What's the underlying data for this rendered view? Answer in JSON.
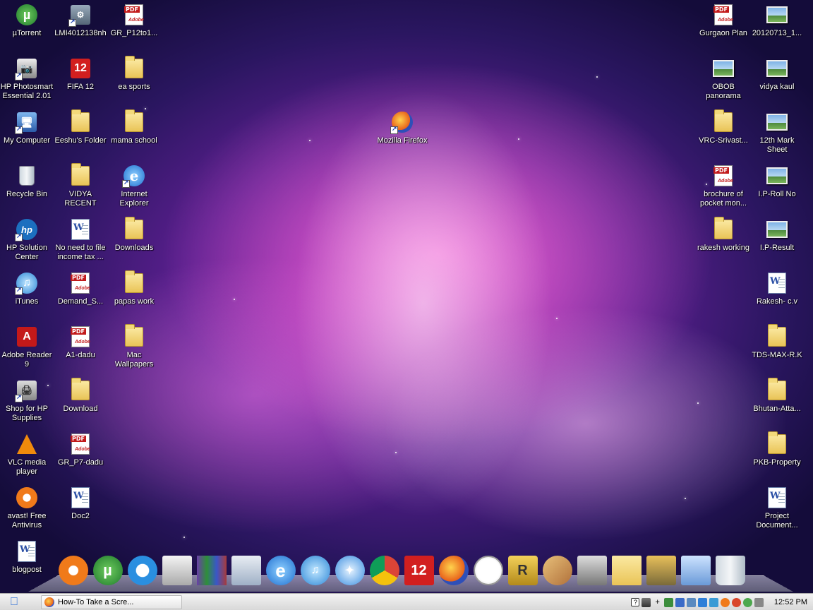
{
  "desktop": {
    "left_icons": [
      {
        "label": "µTorrent",
        "kind": "utorrent"
      },
      {
        "label": "LMI4012138nh",
        "kind": "installer"
      },
      {
        "label": "GR_P12to1...",
        "kind": "pdf"
      },
      {
        "label": "HP Photosmart Essential 2.01",
        "kind": "hp-photo"
      },
      {
        "label": "FIFA 12",
        "kind": "fifa"
      },
      {
        "label": "ea sports",
        "kind": "folder"
      },
      {
        "label": "My Computer",
        "kind": "computer"
      },
      {
        "label": "Eeshu's Folder",
        "kind": "folder"
      },
      {
        "label": "mama school",
        "kind": "folder"
      },
      {
        "label": "Recycle Bin",
        "kind": "recycle"
      },
      {
        "label": "VIDYA RECENT COLLEGES",
        "kind": "folder"
      },
      {
        "label": "Internet Explorer",
        "kind": "ie"
      },
      {
        "label": "HP Solution Center",
        "kind": "hp"
      },
      {
        "label": "No need to file income tax ...",
        "kind": "doc"
      },
      {
        "label": "Downloads",
        "kind": "folder"
      },
      {
        "label": "iTunes",
        "kind": "itunes"
      },
      {
        "label": "Demand_S...",
        "kind": "pdf"
      },
      {
        "label": "papas work",
        "kind": "folder"
      },
      {
        "label": "Adobe Reader 9",
        "kind": "adobe"
      },
      {
        "label": "A1-dadu",
        "kind": "pdf"
      },
      {
        "label": "Mac Wallpapers",
        "kind": "folder"
      },
      {
        "label": "Shop for HP Supplies",
        "kind": "hp-shop"
      },
      {
        "label": "Download",
        "kind": "folder"
      },
      {
        "label": "VLC media player",
        "kind": "vlc"
      },
      {
        "label": "GR_P7-dadu",
        "kind": "pdf"
      },
      {
        "label": "avast! Free Antivirus",
        "kind": "avast"
      },
      {
        "label": "Doc2",
        "kind": "doc"
      },
      {
        "label": "blogpost",
        "kind": "doc"
      }
    ],
    "center_icons": [
      {
        "label": "Mozilla Firefox",
        "kind": "firefox"
      }
    ],
    "right_icons": [
      {
        "label": "Gurgaon Plan",
        "kind": "pdf"
      },
      {
        "label": "20120713_1...",
        "kind": "image"
      },
      {
        "label": "OBOB panorama",
        "kind": "image"
      },
      {
        "label": "vidya kaul",
        "kind": "image"
      },
      {
        "label": "VRC-Srivast...",
        "kind": "folder"
      },
      {
        "label": "12th Mark Sheet",
        "kind": "image"
      },
      {
        "label": "brochure of pocket mon...",
        "kind": "pdf"
      },
      {
        "label": "I.P-Roll No",
        "kind": "image"
      },
      {
        "label": "rakesh working",
        "kind": "folder"
      },
      {
        "label": "I.P-Result",
        "kind": "image"
      },
      {
        "label": "Rakesh- c.v",
        "kind": "doc"
      },
      {
        "label": "TDS-MAX-R.K",
        "kind": "folder"
      },
      {
        "label": "Bhutan-Atta...",
        "kind": "folder-zip"
      },
      {
        "label": "PKB-Property",
        "kind": "folder"
      },
      {
        "label": "Project Document...",
        "kind": "doc"
      }
    ]
  },
  "dock": {
    "items": [
      {
        "name": "avast-dock-icon",
        "kind": "avast"
      },
      {
        "name": "utorrent-dock-icon",
        "kind": "utorrent"
      },
      {
        "name": "quicktime-dock-icon",
        "kind": "quicktime"
      },
      {
        "name": "preview-dock-icon",
        "kind": "preview"
      },
      {
        "name": "winrar-dock-icon",
        "kind": "winrar"
      },
      {
        "name": "documents-stack-dock-icon",
        "kind": "stack"
      },
      {
        "name": "internet-explorer-dock-icon",
        "kind": "ie"
      },
      {
        "name": "itunes-dock-icon",
        "kind": "itunes"
      },
      {
        "name": "safari-dock-icon",
        "kind": "safari"
      },
      {
        "name": "chrome-dock-icon",
        "kind": "chrome"
      },
      {
        "name": "fifa12-dock-icon",
        "kind": "fifa"
      },
      {
        "name": "firefox-dock-icon",
        "kind": "firefox"
      },
      {
        "name": "clock-dock-icon",
        "kind": "clock"
      },
      {
        "name": "rocketdock-dock-icon",
        "kind": "rocket"
      },
      {
        "name": "paint-dock-icon",
        "kind": "paint"
      },
      {
        "name": "system-tools-dock-icon",
        "kind": "tools"
      },
      {
        "name": "folder-dock-icon",
        "kind": "folder"
      },
      {
        "name": "utilities-dock-icon",
        "kind": "utilities"
      },
      {
        "name": "notepad-dock-icon",
        "kind": "notepad"
      },
      {
        "name": "trash-dock-icon",
        "kind": "trash"
      }
    ]
  },
  "taskbar": {
    "task_label": "How-To Take a Scre...",
    "tray_plus": "+",
    "clock": "12:52 PM",
    "colors": {
      "start": "#2b6fd6",
      "bar": "#e6e6e6"
    }
  }
}
